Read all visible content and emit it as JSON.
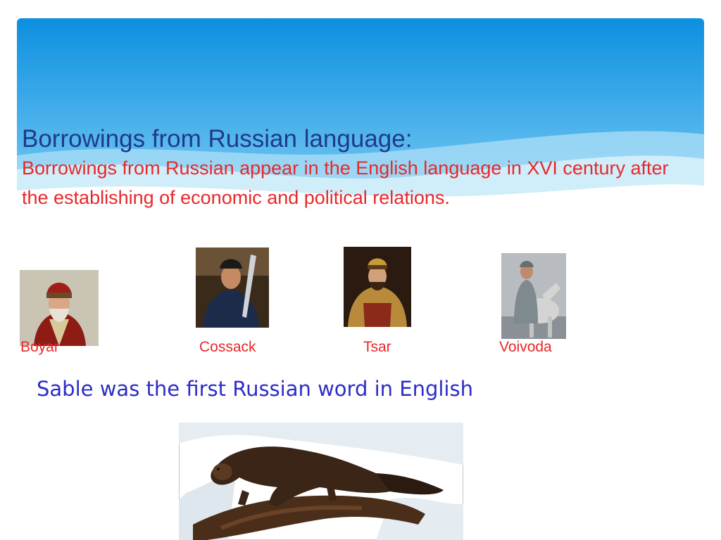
{
  "slide": {
    "title": "Borrowings from Russian language:",
    "body": " Borrowings from Russian appear in the English language in XVI century after the establishing of economic and political relations.",
    "subheading": "Sable was the first Russian word in English"
  },
  "portraits": [
    {
      "caption": "Boyar",
      "image": "boyar-portrait"
    },
    {
      "caption": "Cossack",
      "image": "cossack-portrait"
    },
    {
      "caption": "Tsar",
      "image": "tsar-portrait"
    },
    {
      "caption": "Voivoda",
      "image": "voivoda-portrait"
    }
  ],
  "colors": {
    "title": "#1f3a8a",
    "body": "#e8282a",
    "subheading": "#2d2dc8",
    "banner_top": "#0d8fe0",
    "banner_bottom": "#6ec6f2"
  }
}
